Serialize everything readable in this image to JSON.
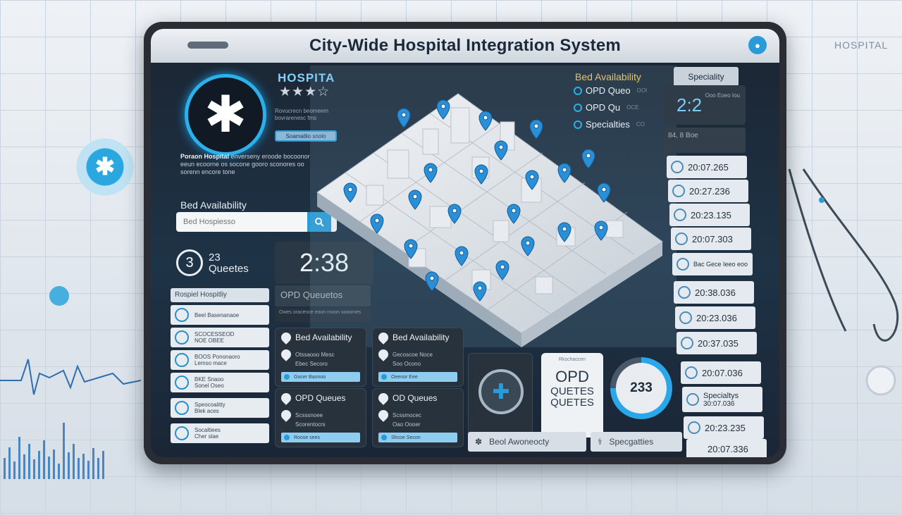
{
  "app": {
    "title": "City-Wide Hospital Integration System",
    "background_label": "HOSPITAL"
  },
  "hospital": {
    "name": "HOSPITA",
    "rating_stars": "★★★☆",
    "summary": "Rovucrecn beomeem bovrarenesc fms",
    "badge": "Soamatlio snolo",
    "description_title": "Poraon Hospital",
    "description": "enverseny eroode bocoonor eeun ecoorne os socone gooro sconores oo sorenn encore tone",
    "bed_availability_label": "Bed Availability",
    "search_placeholder": "Bed Hospiesso"
  },
  "queue": {
    "count": "3",
    "count_label_line1": "23",
    "count_label_line2": "Queetes",
    "big_time": "2:38",
    "opd_title": "OPD Queuetos",
    "opd_sub": "Owes oracence eoon rnoon sooomes",
    "list_header": "Rospiel Hospitliy",
    "list_items": [
      {
        "line1": "Beel Basenanaoe",
        "line2": ""
      },
      {
        "line1": "SCOCESSEOD",
        "line2": "NOE OBEE"
      },
      {
        "line1": "BOOS Pononaoro",
        "line2": "Lemso mace"
      },
      {
        "line1": "BKE Snaoo",
        "line2": "Sonel Oseo"
      },
      {
        "line1": "Speocoalitty",
        "line2": "Blek aces"
      },
      {
        "line1": "Socaltiees",
        "line2": "Cher slae"
      }
    ]
  },
  "cards": [
    {
      "title": "Bed Availability",
      "row1": "Otssaooo Mesc",
      "row2": "Ebec Secoro",
      "bar": "Gocer Baonoo"
    },
    {
      "title": "Bed Availability",
      "row1": "Gecoscoe Noce",
      "row2": "Soo Ocono",
      "bar": "Oeenor Eee"
    },
    {
      "title": "OPD Queues",
      "row1": "Scsssnoee",
      "row2": "Scorentocrs",
      "bar": "Roose sees"
    },
    {
      "title": "OD Queues",
      "row1": "Scssmocec",
      "row2": "Oao Oooer",
      "bar": "Shcoe Secon"
    }
  ],
  "opd_card": {
    "small": "Rkschaccen",
    "big": "OPD",
    "line1": "QUETES",
    "line2": "QUETES"
  },
  "gauge": {
    "value": "233",
    "fill_fraction": 0.75
  },
  "bottom_pills": [
    "Beol Awoneocty",
    "Specgatties"
  ],
  "right_panel": {
    "bed_availability_title": "Bed Availability",
    "speciality_title": "Speciality",
    "legend": [
      {
        "label": "OPD Queo",
        "extra": "OOI"
      },
      {
        "label": "OPD Qu",
        "extra": "OCE"
      },
      {
        "label": "Specialties",
        "extra": "CO"
      }
    ],
    "big_value": "2:2",
    "big_value_side": "Ooo Eoeo Iou",
    "block_text": "84, 8 Boe",
    "times": [
      "20:07.265",
      "20:27.236",
      "20:23.135",
      "20:07.303",
      "Bac Gece Ieeo eoo",
      "20:38.036",
      "20:23.036",
      "20:37.035",
      "20:07.036",
      "Specialtys",
      "20:23.235",
      "20:07.336"
    ],
    "time_sub": "30:07.036"
  },
  "colors": {
    "accent": "#2a9ad8",
    "brand_blue": "#2ab0ea",
    "screen_bg": "#1b2532",
    "gold_title": "#e6c36a"
  },
  "icons": {
    "logo": "star-of-life-icon",
    "search": "search-icon",
    "map_marker": "map-pin-icon",
    "medical": "medical-cross-icon"
  }
}
